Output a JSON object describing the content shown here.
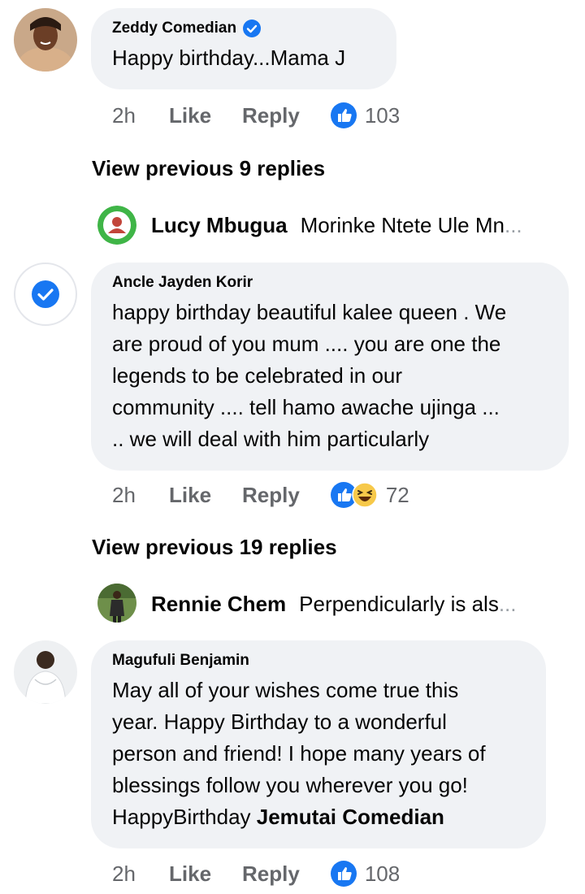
{
  "comments": [
    {
      "author": "Zeddy Comedian",
      "verified": true,
      "text": "Happy birthday...Mama J",
      "time": "2h",
      "like_label": "Like",
      "reply_label": "Reply",
      "reactions": [
        "like-icon"
      ],
      "reaction_count": "103"
    },
    {
      "author": "Ancle Jayden Korir",
      "verified": false,
      "text_lines": [
        "happy birthday beautiful kalee queen . We",
        "are proud  of you mum .... you are one the",
        "legends to be celebrated  in our",
        "community .... tell hamo awache ujinga ...",
        ".. we will deal with him particularly"
      ],
      "time": "2h",
      "like_label": "Like",
      "reply_label": "Reply",
      "reactions": [
        "like-icon",
        "haha-icon"
      ],
      "reaction_count": "72"
    },
    {
      "author": "Magufuli Benjamin",
      "verified": false,
      "text_lines": [
        "May all of your wishes come true this",
        "year. Happy Birthday to a wonderful",
        "person and friend! I hope many years of",
        "blessings follow you wherever you go!"
      ],
      "last_line_prefix": "HappyBirthday ",
      "last_line_tag": "Jemutai Comedian",
      "time": "2h",
      "like_label": "Like",
      "reply_label": "Reply",
      "reactions": [
        "like-icon"
      ],
      "reaction_count": "108"
    }
  ],
  "view_previous": [
    {
      "label": "View previous 9 replies"
    },
    {
      "label": "View previous 19 replies"
    }
  ],
  "reply_previews": [
    {
      "name": "Lucy Mbugua",
      "text": "Morinke Ntete Ule Mn",
      "ellipsis": "..."
    },
    {
      "name": "Rennie Chem",
      "text": "Perpendicularly is als",
      "ellipsis": "..."
    }
  ],
  "colors": {
    "like_blue": "#1877f2",
    "bubble_bg": "#f0f2f5",
    "meta_gray": "#65676b",
    "haha_yellow": "#f7c94a"
  }
}
